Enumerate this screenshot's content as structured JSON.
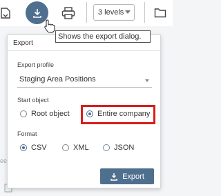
{
  "toolbar": {
    "levels_value": "3 levels",
    "icons": [
      "export-icon",
      "print-icon",
      "folder-icon",
      "view-icon"
    ]
  },
  "tooltip": {
    "text": "Shows the export dialog."
  },
  "background": {
    "side_text": "ees"
  },
  "export_panel": {
    "title": "Export",
    "profile_label": "Export profile",
    "profile_value": "Staging Area Positions",
    "start_object_label": "Start object",
    "start_options": [
      {
        "label": "Root object",
        "checked": false
      },
      {
        "label": "Entire company",
        "checked": true
      }
    ],
    "format_label": "Format",
    "format_options": [
      {
        "label": "CSV",
        "checked": true
      },
      {
        "label": "XML",
        "checked": false
      },
      {
        "label": "JSON",
        "checked": false
      }
    ],
    "export_button": "Export"
  },
  "colors": {
    "accent": "#4f6f8f",
    "highlight": "#d91c1c"
  }
}
